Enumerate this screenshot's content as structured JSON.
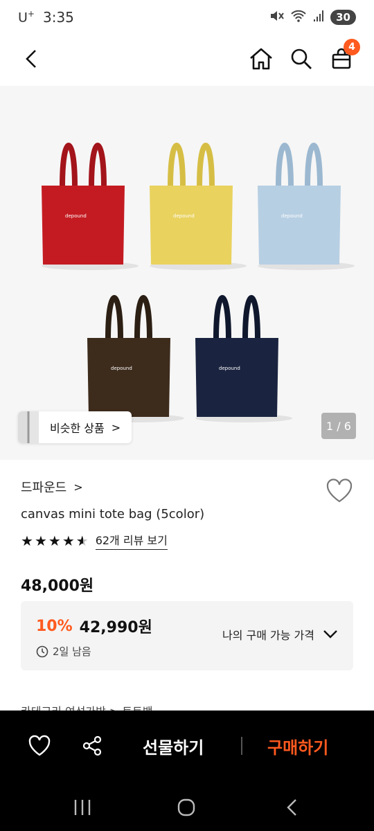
{
  "status": {
    "carrier": "U",
    "carrier_sup": "+",
    "time": "3:35",
    "battery": "30"
  },
  "nav": {
    "cart_count": "4"
  },
  "gallery": {
    "similar_label": "비슷한 상품",
    "similar_arrow": ">",
    "page_indicator": "1 / 6",
    "bags": [
      {
        "color": "#c41b22",
        "handle": "#a3141b",
        "logo": "depound"
      },
      {
        "color": "#e9d25e",
        "handle": "#d6be45",
        "logo": "depound"
      },
      {
        "color": "#b7cfe3",
        "handle": "#9bb8d0",
        "logo": "depound"
      },
      {
        "color": "#3d2b1c",
        "handle": "#2c1f13",
        "logo": "depound"
      },
      {
        "color": "#1a2440",
        "handle": "#10182e",
        "logo": "depound"
      }
    ]
  },
  "product": {
    "brand": "드파운드",
    "brand_chevron": ">",
    "name": "canvas mini tote bag (5color)",
    "review_link": "62개 리뷰 보기",
    "rating": 4.5,
    "price_original": "48,000원"
  },
  "promo": {
    "discount": "10%",
    "sale_price": "42,990원",
    "remaining": "2일 남음",
    "my_price_label": "나의 구매 가능 가격"
  },
  "category_peek": "카테고리      여성가방 > 토트백",
  "bottom": {
    "gift_label": "선물하기",
    "buy_label": "구매하기"
  },
  "colors": {
    "accent": "#ff5a1f"
  }
}
